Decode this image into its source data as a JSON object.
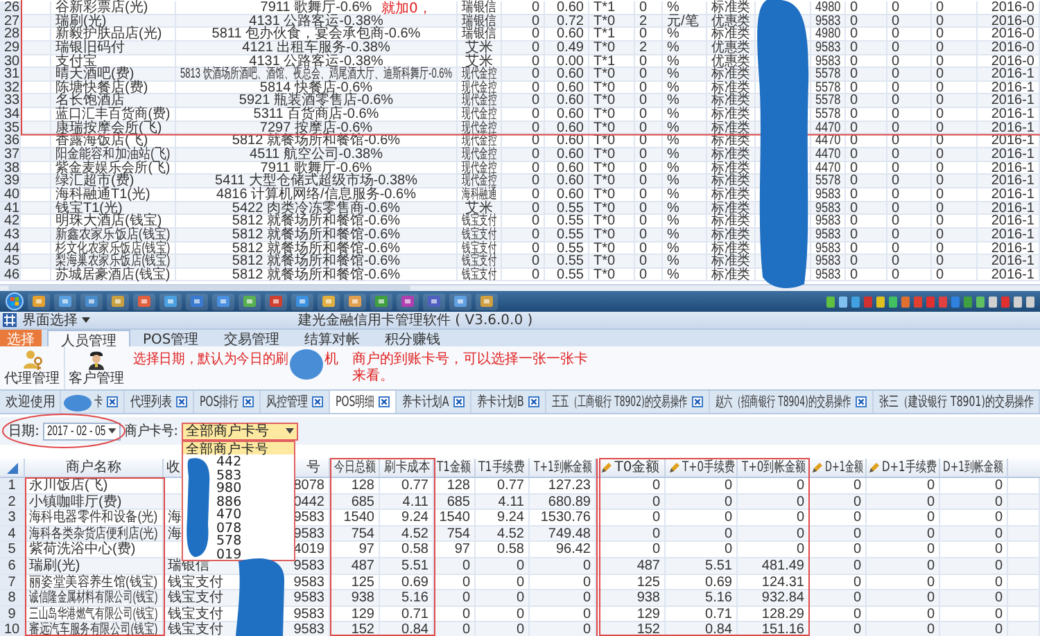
{
  "sheet": {
    "note": "就加0，",
    "rows": [
      {
        "no": "26",
        "cells": [
          "谷新彩票店(光)",
          "7911 歌舞厅-0.6%",
          "瑞银信",
          "0",
          "0.60",
          "T*1",
          "0",
          "%",
          "标准类",
          "4980",
          "0",
          "0",
          "0",
          "2016-0"
        ]
      },
      {
        "no": "27",
        "cells": [
          "瑞刷(光)",
          "4131 公路客运-0.38%",
          "瑞银信",
          "0",
          "0.72",
          "T*0",
          "2",
          "元/笔",
          "优惠类",
          "9583",
          "0",
          "0",
          "0",
          "2016-0"
        ]
      },
      {
        "no": "28",
        "cells": [
          "新毅护肤品店(光)",
          "5811 包办伙食，宴会承包商-0.6%",
          "瑞银信",
          "0",
          "0.60",
          "T*1",
          "0",
          "%",
          "标准类",
          "4980",
          "0",
          "0",
          "0",
          "2016-0"
        ]
      },
      {
        "no": "29",
        "cells": [
          "瑞银旧码付",
          "4121 出租车服务-0.38%",
          "艾米",
          "0",
          "0.49",
          "T*0",
          "2",
          "%",
          "优惠类",
          "9583",
          "0",
          "0",
          "0",
          "2016-0"
        ]
      },
      {
        "no": "30",
        "cells": [
          "支付宝",
          "4131 公路客运-0.38%",
          "艾米",
          "0",
          "0.00",
          "T*1",
          "0",
          "%",
          "优惠类",
          "9583",
          "0",
          "0",
          "0",
          "2016-0"
        ]
      },
      {
        "no": "31",
        "cells": [
          "晴天酒吧(费)",
          "5813 饮酒场所酒吧、酒馆、夜总会、鸡尾酒大厅、迪斯科舞厅-0.6%",
          "现代金控",
          "0",
          "0.60",
          "T*0",
          "0",
          "%",
          "标准类",
          "5578",
          "0",
          "0",
          "0",
          "2016-1"
        ]
      },
      {
        "no": "32",
        "cells": [
          "陈塘快餐店(费)",
          "5814 快餐店-0.6%",
          "现代金控",
          "0",
          "0.60",
          "T*0",
          "0",
          "%",
          "标准类",
          "5578",
          "0",
          "0",
          "0",
          "2016-1"
        ]
      },
      {
        "no": "33",
        "cells": [
          "名长饱酒店",
          "5921 瓶装酒零售店-0.6%",
          "现代金控",
          "0",
          "0.60",
          "T*0",
          "0",
          "%",
          "标准类",
          "5578",
          "0",
          "0",
          "0",
          "2016-1"
        ]
      },
      {
        "no": "34",
        "cells": [
          "蓝口汇丰百货商(费)",
          "5311 百货商店-0.6%",
          "现代金控",
          "0",
          "0.60",
          "T*0",
          "0",
          "%",
          "标准类",
          "5578",
          "0",
          "0",
          "0",
          "2016-1"
        ]
      },
      {
        "no": "35",
        "cells": [
          "康瑞按摩会所(飞)",
          "7297 按摩店-0.6%",
          "现代金控",
          "0",
          "0.60",
          "T*0",
          "0",
          "%",
          "标准类",
          "4470",
          "0",
          "0",
          "0",
          "2016-1"
        ]
      },
      {
        "no": "36",
        "cells": [
          "香露海饭店(飞)",
          "5812 就餐场所和餐馆-0.6%",
          "现代金控",
          "0",
          "0.60",
          "T*0",
          "0",
          "%",
          "标准类",
          "4470",
          "0",
          "0",
          "0",
          "2016-1"
        ]
      },
      {
        "no": "37",
        "cells": [
          "阳金能容和加油站(飞)",
          "4511 航空公司-0.38%",
          "现代金控",
          "0",
          "0.60",
          "T*0",
          "0",
          "%",
          "标准类",
          "4470",
          "0",
          "0",
          "0",
          "2016-1"
        ]
      },
      {
        "no": "38",
        "cells": [
          "紫金麦娱乐会所(飞)",
          "7911 歌舞厅-0.6%",
          "现代金控",
          "0",
          "0.60",
          "T*0",
          "0",
          "%",
          "标准类",
          "4470",
          "0",
          "0",
          "0",
          "2016-1"
        ]
      },
      {
        "no": "39",
        "cells": [
          "绿汇超市(费)",
          "5411 大型仓储式超级市场-0.38%",
          "现代金控",
          "0",
          "0.60",
          "T*0",
          "0",
          "%",
          "标准类",
          "5578",
          "0",
          "0",
          "0",
          "2016-1"
        ]
      },
      {
        "no": "40",
        "cells": [
          "海科融通T1(光)",
          "4816 计算机网络/信息服务-0.6%",
          "海科融通",
          "0",
          "0.60",
          "T*0",
          "0",
          "%",
          "标准类",
          "9583",
          "0",
          "0",
          "0",
          "2016-1"
        ]
      },
      {
        "no": "41",
        "cells": [
          "钱宝T1(光)",
          "5422 肉类冷冻零售商-0.6%",
          "艾米",
          "0",
          "0.55",
          "T*0",
          "0",
          "%",
          "标准类",
          "9583",
          "0",
          "0",
          "0",
          "2016-1"
        ]
      },
      {
        "no": "42",
        "cells": [
          "明珠大酒店(钱宝)",
          "5812 就餐场所和餐馆-0.6%",
          "钱宝支付",
          "0",
          "0.55",
          "T*0",
          "0",
          "%",
          "标准类",
          "9583",
          "0",
          "0",
          "0",
          "2016-1"
        ]
      },
      {
        "no": "43",
        "cells": [
          "新鑫农家乐饭店(钱宝)",
          "5812 就餐场所和餐馆-0.6%",
          "钱宝支付",
          "0",
          "0.55",
          "T*0",
          "0",
          "%",
          "标准类",
          "9583",
          "0",
          "0",
          "0",
          "2016-1"
        ]
      },
      {
        "no": "44",
        "cells": [
          "杉文化农家乐饭店(钱宝)",
          "5812 就餐场所和餐馆-0.6%",
          "钱宝支付",
          "0",
          "0.55",
          "T*0",
          "0",
          "%",
          "标准类",
          "9583",
          "0",
          "0",
          "0",
          "2016-1"
        ]
      },
      {
        "no": "45",
        "cells": [
          "梨海巢农家乐饭店(钱宝)",
          "5812 就餐场所和餐馆-0.6%",
          "钱宝支付",
          "0",
          "0.55",
          "T*0",
          "0",
          "%",
          "标准类",
          "9583",
          "0",
          "0",
          "0",
          "2016-1"
        ]
      },
      {
        "no": "46",
        "cells": [
          "苏城居豪酒店(钱宝)",
          "5812 就餐场所和餐馆-0.6%",
          "钱宝支付",
          "0",
          "0.55",
          "T*0",
          "0",
          "%",
          "标准类",
          "9583",
          "0",
          "0",
          "0",
          "2016-1"
        ]
      }
    ]
  },
  "window": {
    "menu": "界面选择",
    "title": "建光金融信用卡管理软件 ( V3.6.0.0 )"
  },
  "ribbon": {
    "tabs": [
      {
        "label": "选择",
        "kind": "app",
        "selected": false
      },
      {
        "label": "人员管理",
        "kind": "tab",
        "selected": true
      },
      {
        "label": "POS管理",
        "kind": "tab",
        "selected": false
      },
      {
        "label": "交易管理",
        "kind": "tab",
        "selected": false
      },
      {
        "label": "结算对帐",
        "kind": "tab",
        "selected": false
      },
      {
        "label": "积分赚钱",
        "kind": "tab",
        "selected": false
      }
    ],
    "buttons": [
      {
        "label": "代理管理",
        "kind": "agent"
      },
      {
        "label": "客户管理",
        "kind": "customer"
      }
    ]
  },
  "annotations": [
    {
      "text": "选择日期，默认为今日的刷"
    },
    {
      "text": "机"
    },
    {
      "text": "商户的到账卡号，可以选择一张一张卡来看。"
    }
  ],
  "doc_tabs": [
    {
      "label": "欢迎使用",
      "closable": false,
      "selected": false
    },
    {
      "label": "卡",
      "closable": true,
      "selected": false
    },
    {
      "label": "代理列表",
      "closable": true,
      "selected": false
    },
    {
      "label": "POS排行",
      "closable": true,
      "selected": false
    },
    {
      "label": "风控管理",
      "closable": true,
      "selected": false
    },
    {
      "label": "POS明细",
      "closable": true,
      "selected": true
    },
    {
      "label": "养卡计划A",
      "closable": true,
      "selected": false
    },
    {
      "label": "养卡计划B",
      "closable": true,
      "selected": false
    },
    {
      "label": "王五（工商银行 T8902)的交易操作",
      "closable": true,
      "selected": false
    },
    {
      "label": "赵六（招商银行 T8904)的交易操作",
      "closable": true,
      "selected": false
    },
    {
      "label": "张三（建设银行 T8901)的交易操作",
      "closable": false,
      "selected": false
    }
  ],
  "filter": {
    "date_label": "日期:",
    "date": "2017 - 02 - 05",
    "card_label": "商户卡号:",
    "card": "全部商户卡号",
    "options": [
      {
        "label": "全部商户卡号",
        "selected": true
      },
      {
        "label": "442",
        "selected": false
      },
      {
        "label": "583",
        "selected": false
      },
      {
        "label": "980",
        "selected": false
      },
      {
        "label": "886",
        "selected": false
      },
      {
        "label": "470",
        "selected": false
      },
      {
        "label": "078",
        "selected": false
      },
      {
        "label": "578",
        "selected": false
      },
      {
        "label": "019",
        "selected": false
      }
    ]
  },
  "grid": {
    "columns": [
      {
        "label": "商户名称",
        "editable": false
      },
      {
        "label": "收",
        "editable": false
      },
      {
        "label": "号",
        "editable": false
      },
      {
        "label": "今日总额",
        "editable": false
      },
      {
        "label": "刷卡成本",
        "editable": false
      },
      {
        "label": "T1金额",
        "editable": false
      },
      {
        "label": "T1手续费",
        "editable": false
      },
      {
        "label": "T+1到帐金额",
        "editable": false
      },
      {
        "label": "T0金额",
        "editable": true
      },
      {
        "label": "T+0手续费",
        "editable": true
      },
      {
        "label": "T+0到帐金额",
        "editable": false
      },
      {
        "label": "D+1金额",
        "editable": true
      },
      {
        "label": "D+1手续费",
        "editable": true
      },
      {
        "label": "D+1到帐金额",
        "editable": false
      }
    ],
    "rows": [
      {
        "no": "1",
        "cells": [
          "永川饭店(飞)",
          null,
          "8078",
          "128",
          "0.77",
          "128",
          "0.77",
          "127.23",
          "0",
          "0",
          "0",
          "0",
          "0",
          "0"
        ]
      },
      {
        "no": "2",
        "cells": [
          "小镇咖啡厅(费)",
          null,
          "0442",
          "685",
          "4.11",
          "685",
          "4.11",
          "680.89",
          "0",
          "0",
          "0",
          "0",
          "0",
          "0"
        ]
      },
      {
        "no": "3",
        "cells": [
          "海科电器零件和设备(光)",
          "海",
          "9583",
          "1540",
          "9.24",
          "1540",
          "9.24",
          "1530.76",
          "0",
          "0",
          "0",
          "0",
          "0",
          "0"
        ]
      },
      {
        "no": "4",
        "cells": [
          "海科各类杂货店便利店(光)",
          "海",
          "9583",
          "754",
          "4.52",
          "754",
          "4.52",
          "749.48",
          "0",
          "0",
          "0",
          "0",
          "0",
          "0"
        ]
      },
      {
        "no": "5",
        "cells": [
          "紫荷洗浴中心(费)",
          null,
          "4019",
          "97",
          "0.58",
          "97",
          "0.58",
          "96.42",
          "0",
          "0",
          "0",
          "0",
          "0",
          "0"
        ]
      },
      {
        "no": "6",
        "cells": [
          "瑞刷(光)",
          "瑞银信",
          "9583",
          "487",
          "5.51",
          "0",
          "0",
          "0",
          "487",
          "5.51",
          "481.49",
          "0",
          "0",
          "0"
        ]
      },
      {
        "no": "7",
        "cells": [
          "丽姿堂美容养生馆(钱宝)",
          "钱宝支付",
          "9583",
          "125",
          "0.69",
          "0",
          "0",
          "0",
          "125",
          "0.69",
          "124.31",
          "0",
          "0",
          "0"
        ]
      },
      {
        "no": "8",
        "cells": [
          "诚信隆金属材料有限公司(钱宝)",
          "钱宝支付",
          "9583",
          "938",
          "5.16",
          "0",
          "0",
          "0",
          "938",
          "5.16",
          "932.84",
          "0",
          "0",
          "0"
        ]
      },
      {
        "no": "9",
        "cells": [
          "三山岛华港燃气有限公司(钱宝)",
          "钱宝支付",
          "9583",
          "129",
          "0.71",
          "0",
          "0",
          "0",
          "129",
          "0.71",
          "128.29",
          "0",
          "0",
          "0"
        ]
      },
      {
        "no": "10",
        "cells": [
          "審远汽车服务有限公司(钱宝)",
          "钱宝支付",
          "9583",
          "152",
          "0.84",
          "0",
          "0",
          "0",
          "152",
          "0.84",
          "151.16",
          "0",
          "0",
          "0"
        ]
      }
    ]
  }
}
